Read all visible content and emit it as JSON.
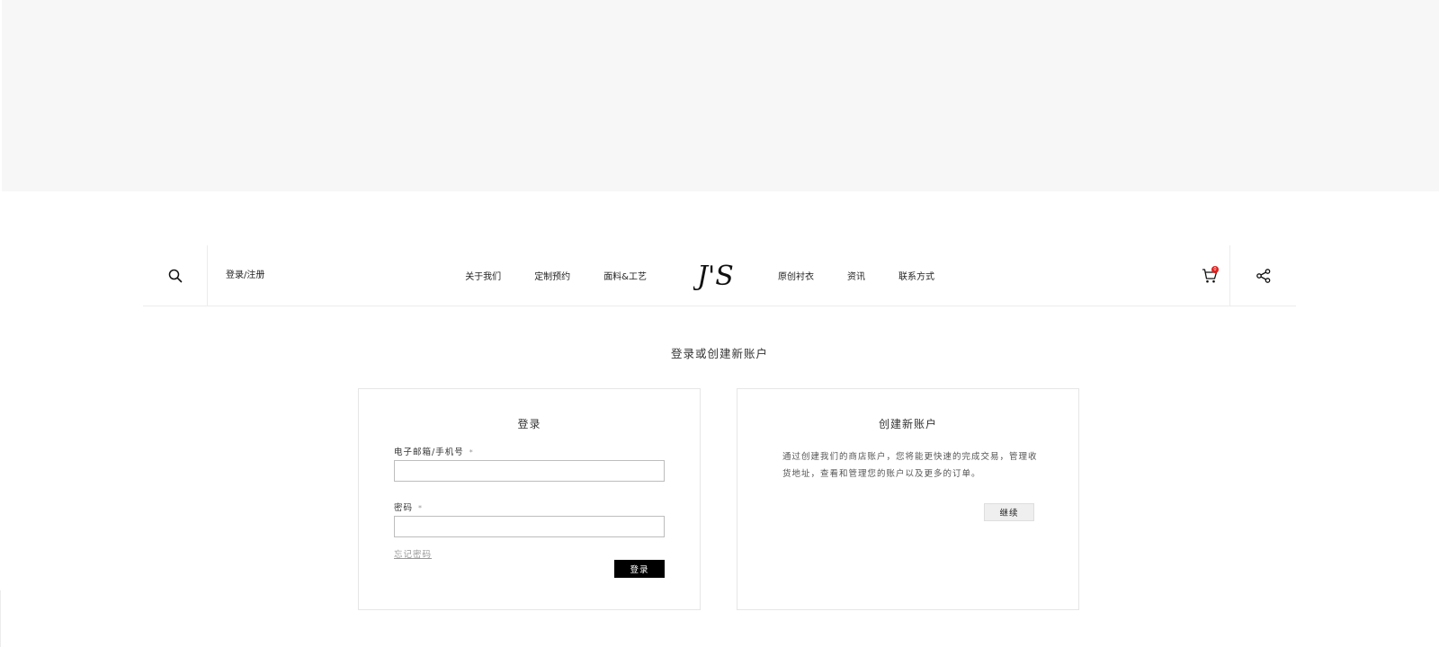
{
  "header": {
    "login_register": "登录/注册",
    "nav_left": [
      "关于我们",
      "定制预约",
      "面料&工艺"
    ],
    "logo_text": "J'S",
    "nav_right": [
      "原创衬衣",
      "资讯",
      "联系方式"
    ],
    "cart_count": "0"
  },
  "page_title": "登录或创建新账户",
  "login_card": {
    "title": "登录",
    "email_label": "电子邮箱/手机号",
    "password_label": "密码",
    "required_mark": "*",
    "email_value": "",
    "password_value": "",
    "forgot_password": "忘记密码",
    "submit_label": "登录"
  },
  "register_card": {
    "title": "创建新账户",
    "description": "通过创建我们的商店账户，您将能更快速的完成交易，管理收货地址，查看和管理您的账户以及更多的订单。",
    "continue_label": "继续"
  },
  "colors": {
    "hero_band": "#f7f7f7",
    "primary_button": "#000000",
    "badge": "#e0201e"
  }
}
